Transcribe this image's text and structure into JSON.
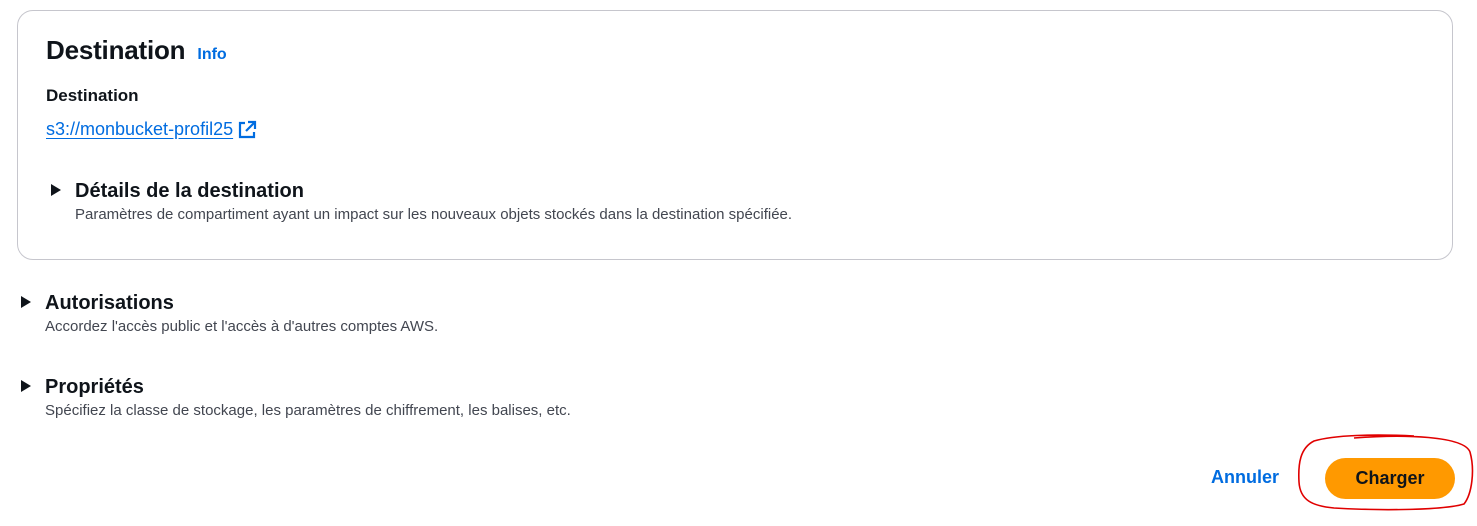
{
  "destination_card": {
    "title": "Destination",
    "info_label": "Info",
    "field_label": "Destination",
    "s3_url": "s3://monbucket-profil25",
    "external_icon": "external-link-icon"
  },
  "sections": {
    "destination_details": {
      "title": "Détails de la destination",
      "description": "Paramètres de compartiment ayant un impact sur les nouveaux objets stockés dans la destination spécifiée."
    },
    "permissions": {
      "title": "Autorisations",
      "description": "Accordez l'accès public et l'accès à d'autres comptes AWS."
    },
    "properties": {
      "title": "Propriétés",
      "description": "Spécifiez la classe de stockage, les paramètres de chiffrement, les balises, etc."
    }
  },
  "actions": {
    "cancel_label": "Annuler",
    "upload_label": "Charger"
  },
  "colors": {
    "link": "#006ce0",
    "primary_button": "#ff9900",
    "annotation": "#e00000"
  }
}
